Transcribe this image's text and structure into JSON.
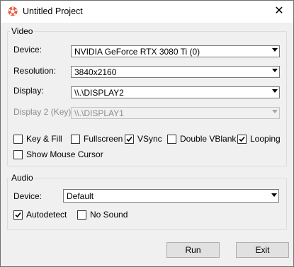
{
  "window": {
    "title": "Untitled Project",
    "close_glyph": "✕",
    "icon": "app-logo-icon"
  },
  "video": {
    "legend": "Video",
    "device": {
      "label": "Device:",
      "value": "NVIDIA GeForce RTX 3080 Ti (0)"
    },
    "resolution": {
      "label": "Resolution:",
      "value": "3840x2160"
    },
    "display": {
      "label": "Display:",
      "value": "\\\\.\\DISPLAY2"
    },
    "display2": {
      "label": "Display 2 (Key):",
      "value": "\\\\.\\DISPLAY1"
    },
    "checkboxes": {
      "key_fill": {
        "label": "Key & Fill",
        "checked": false
      },
      "fullscreen": {
        "label": "Fullscreen",
        "checked": false
      },
      "vsync": {
        "label": "VSync",
        "checked": true
      },
      "double_vblank": {
        "label": "Double VBlank",
        "checked": false
      },
      "looping": {
        "label": "Looping",
        "checked": true
      },
      "show_mouse": {
        "label": "Show Mouse Cursor",
        "checked": false
      }
    }
  },
  "audio": {
    "legend": "Audio",
    "device": {
      "label": "Device:",
      "value": "Default"
    },
    "checkboxes": {
      "autodetect": {
        "label": "Autodetect",
        "checked": true
      },
      "no_sound": {
        "label": "No Sound",
        "checked": false
      }
    }
  },
  "buttons": {
    "run": "Run",
    "exit": "Exit"
  }
}
